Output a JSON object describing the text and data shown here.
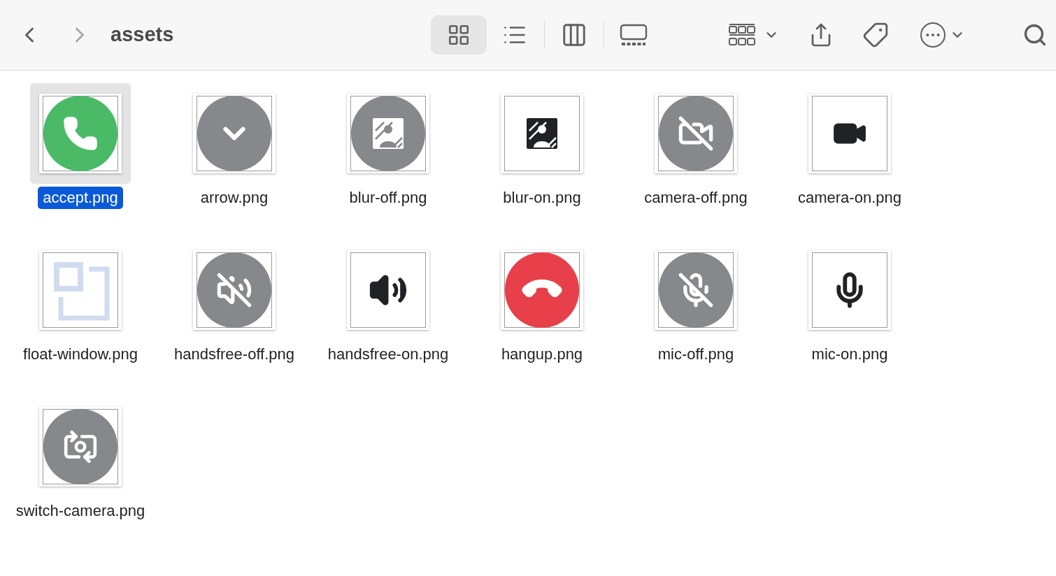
{
  "toolbar": {
    "title": "assets",
    "views": [
      {
        "kind": "icons",
        "selected": true
      },
      {
        "kind": "list",
        "selected": false
      },
      {
        "kind": "columns",
        "selected": false
      },
      {
        "kind": "gallery",
        "selected": false
      }
    ]
  },
  "files": [
    {
      "name": "accept.png",
      "kind": "accept",
      "selected": true
    },
    {
      "name": "arrow.png",
      "kind": "arrow",
      "selected": false
    },
    {
      "name": "blur-off.png",
      "kind": "bluroff",
      "selected": false
    },
    {
      "name": "blur-on.png",
      "kind": "bluron",
      "selected": false
    },
    {
      "name": "camera-off.png",
      "kind": "cameraoff",
      "selected": false
    },
    {
      "name": "camera-on.png",
      "kind": "cameraon",
      "selected": false
    },
    {
      "name": "float-window.png",
      "kind": "floatwindow",
      "selected": false
    },
    {
      "name": "handsfree-off.png",
      "kind": "handsfreeoff",
      "selected": false
    },
    {
      "name": "handsfree-on.png",
      "kind": "handsfreeon",
      "selected": false
    },
    {
      "name": "hangup.png",
      "kind": "hangup",
      "selected": false
    },
    {
      "name": "mic-off.png",
      "kind": "micoff",
      "selected": false
    },
    {
      "name": "mic-on.png",
      "kind": "micon",
      "selected": false
    },
    {
      "name": "switch-camera.png",
      "kind": "switchcamera",
      "selected": false
    }
  ]
}
